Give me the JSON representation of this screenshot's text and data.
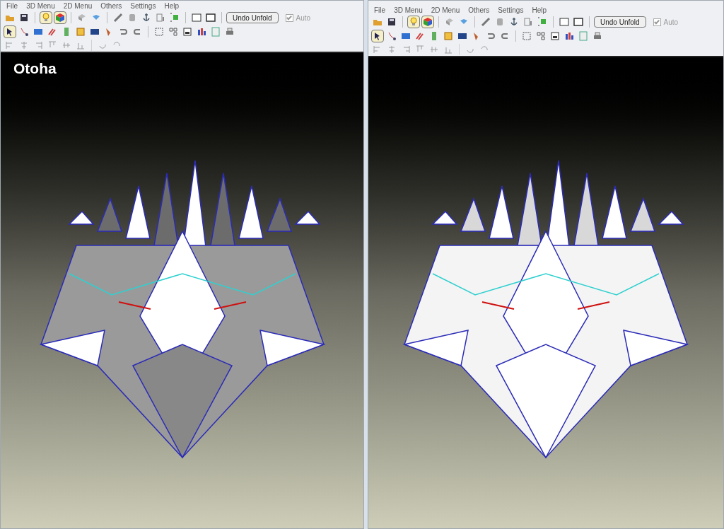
{
  "windows": [
    {
      "menu": [
        "File",
        "3D Menu",
        "2D Menu",
        "Others",
        "Settings",
        "Help"
      ],
      "undo_button": "Undo Unfold",
      "auto": {
        "label": "Auto",
        "checked": true,
        "disabled": true
      },
      "toggles": {
        "lighting": true,
        "texture": true,
        "select": true
      },
      "caption": "Otoha",
      "white_model": false
    },
    {
      "menu": [
        "File",
        "3D Menu",
        "2D Menu",
        "Others",
        "Settings",
        "Help"
      ],
      "undo_button": "Undo Unfold",
      "auto": {
        "label": "Auto",
        "checked": true,
        "disabled": true
      },
      "toggles": {
        "lighting": true,
        "texture": true,
        "select": true
      },
      "white_model": true
    }
  ]
}
